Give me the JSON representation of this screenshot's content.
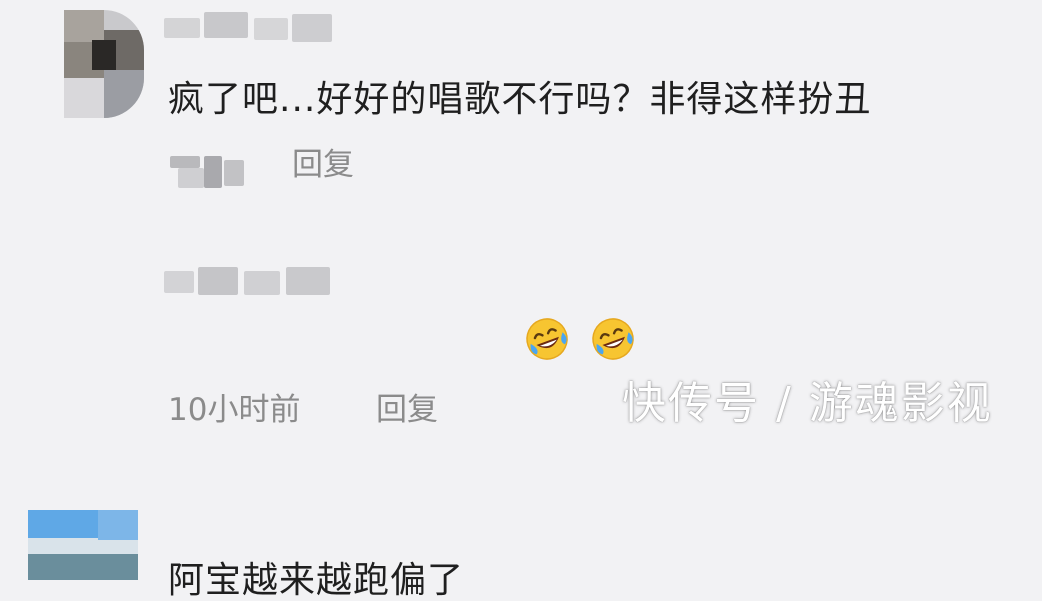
{
  "comments": [
    {
      "text": "疯了吧...好好的唱歌不行吗？非得这样扮丑",
      "time": "",
      "reply_label": "回复"
    },
    {
      "text": "阿宝越来越跑偏了",
      "time": "10小时前",
      "reply_label": "回复",
      "emojis": [
        "rolling-on-floor-laughing",
        "rolling-on-floor-laughing"
      ]
    }
  ],
  "watermark": "快传号 / 游魂影视",
  "colors": {
    "background": "#f2f2f4",
    "text": "#1f1f1f",
    "meta_text": "#8b8b8b",
    "emoji_yellow": "#f7c531",
    "emoji_tear": "#4ba6f0"
  }
}
